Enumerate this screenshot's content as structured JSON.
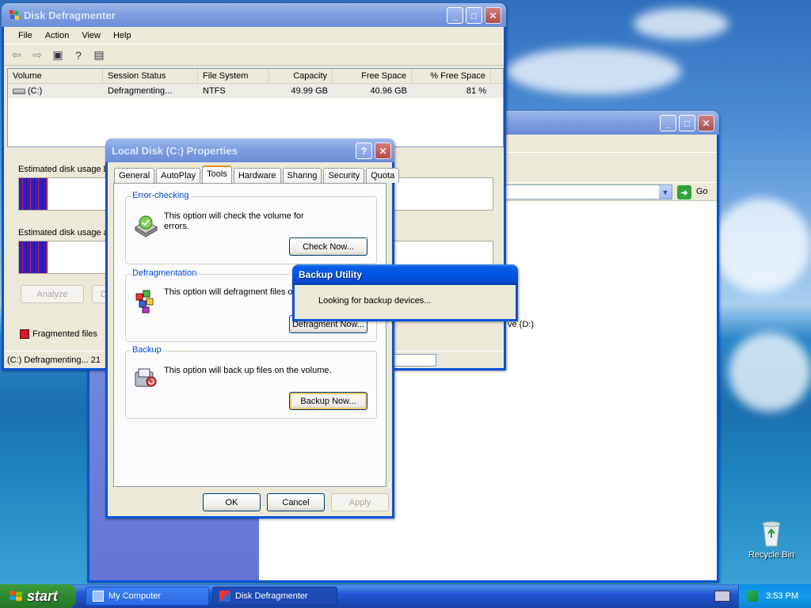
{
  "defrag_window": {
    "title": "Disk Defragmenter",
    "menu": [
      "File",
      "Action",
      "View",
      "Help"
    ],
    "columns": [
      "Volume",
      "Session Status",
      "File System",
      "Capacity",
      "Free Space",
      "% Free Space"
    ],
    "row": {
      "volume": "(C:)",
      "status": "Defragmenting...",
      "fs": "NTFS",
      "capacity": "49.99 GB",
      "free": "40.96 GB",
      "pct": "81 %"
    },
    "est_before_label": "Estimated disk usage b",
    "est_after_label": "Estimated disk usage af",
    "analyze_label": "Analyze",
    "defrag_partial_label": "D",
    "legend_fragmented": "Fragmented files",
    "status_text": "(C:) Defragmenting... 21"
  },
  "mycomputer_window": {
    "go_label": "Go",
    "drive_partial": "ve (D:)"
  },
  "properties_dialog": {
    "title": "Local Disk (C:) Properties",
    "tabs": [
      "General",
      "AutoPlay",
      "Tools",
      "Hardware",
      "Sharing",
      "Security",
      "Quota"
    ],
    "active_tab": "Tools",
    "error_checking": {
      "title": "Error-checking",
      "text": "This option will check the volume for errors.",
      "button": "Check Now..."
    },
    "defragmentation": {
      "title": "Defragmentation",
      "text": "This option will defragment files on",
      "button": "Defragment Now..."
    },
    "backup": {
      "title": "Backup",
      "text": "This option will back up files on the volume.",
      "button": "Backup Now..."
    },
    "ok_label": "OK",
    "cancel_label": "Cancel",
    "apply_label": "Apply"
  },
  "backup_utility": {
    "title": "Backup Utility",
    "message": "Looking for backup devices..."
  },
  "taskbar": {
    "start_label": "start",
    "tasks": [
      "My Computer",
      "Disk Defragmenter"
    ],
    "clock": "3:53 PM"
  },
  "desktop": {
    "recycle_bin_label": "Recycle Bin"
  },
  "colors": {
    "title_active": "#0055e5",
    "window_bg": "#ece9d8",
    "fragmented": "#d41a2a",
    "start_green": "#2f8a2f"
  }
}
